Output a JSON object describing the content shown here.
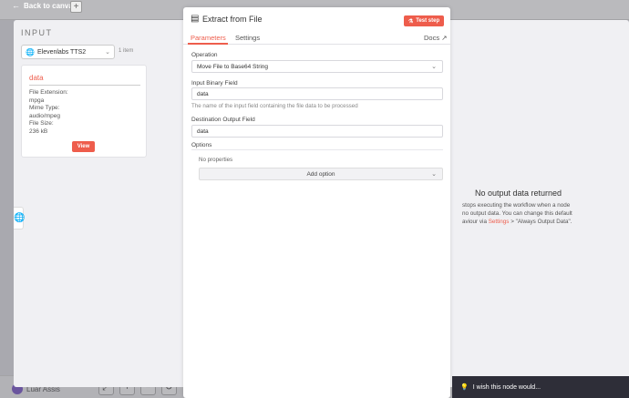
{
  "nav": {
    "back_label": "Back to canvas",
    "add_label": "+"
  },
  "input": {
    "title": "INPUT",
    "node_name": "Elevenlabs TTS2",
    "item_count": "1 item",
    "binary": {
      "name": "data",
      "ext_label": "File Extension:",
      "ext_value": "mpga",
      "mime_label": "Mime Type:",
      "mime_value": "audio/mpeg",
      "size_label": "File Size:",
      "size_value": "236 kB",
      "view_label": "View"
    }
  },
  "panel": {
    "title": "Extract from File",
    "test_label": "Test step",
    "tabs": [
      {
        "label": "Parameters"
      },
      {
        "label": "Settings"
      }
    ],
    "docs_label": "Docs",
    "operation": {
      "label": "Operation",
      "value": "Move File to Base64 String"
    },
    "binary_field": {
      "label": "Input Binary Field",
      "value": "data",
      "hint": "The name of the input field containing the file data to be processed"
    },
    "dest_field": {
      "label": "Destination Output Field",
      "value": "data"
    },
    "options": {
      "label": "Options",
      "empty": "No properties",
      "add_label": "Add option"
    }
  },
  "output": {
    "title": "No output data returned",
    "line1": "stops executing the workflow when a node",
    "line2": "no output data. You can change this default",
    "line3_pre": "aviour via ",
    "line3_link": "Settings",
    "line3_post": " > \"Always Output Data\"."
  },
  "footer": {
    "user": "Luar Assis",
    "wish_label": "I wish this node would..."
  },
  "colors": {
    "accent": "#ee5d4c",
    "link": "#4a6fe0"
  }
}
